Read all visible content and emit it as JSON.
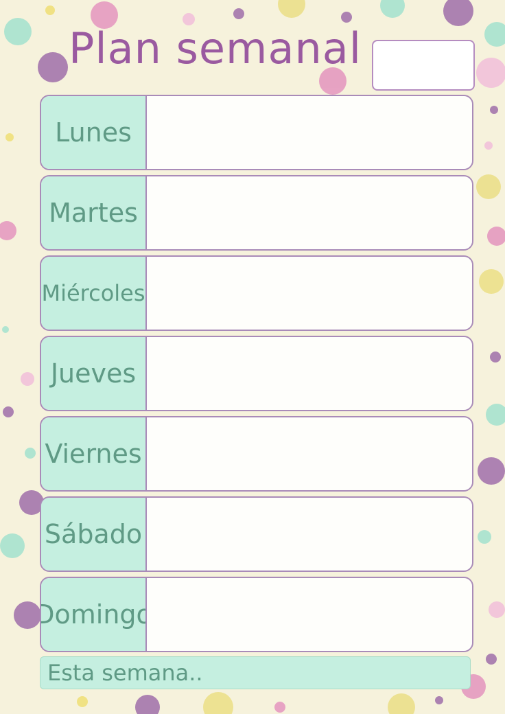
{
  "title": "Plan semanal",
  "days": [
    {
      "label": "Lunes"
    },
    {
      "label": "Martes"
    },
    {
      "label": "Miércoles"
    },
    {
      "label": "Jueves"
    },
    {
      "label": "Viernes"
    },
    {
      "label": "Sábado"
    },
    {
      "label": "Domingo"
    }
  ],
  "footer_label": "Esta semana..",
  "colors": {
    "background": "#f6f2dc",
    "title": "#9a5aa0",
    "mint": "#c5efe0",
    "label_text": "#5f9a85",
    "border": "#a98bb8"
  }
}
